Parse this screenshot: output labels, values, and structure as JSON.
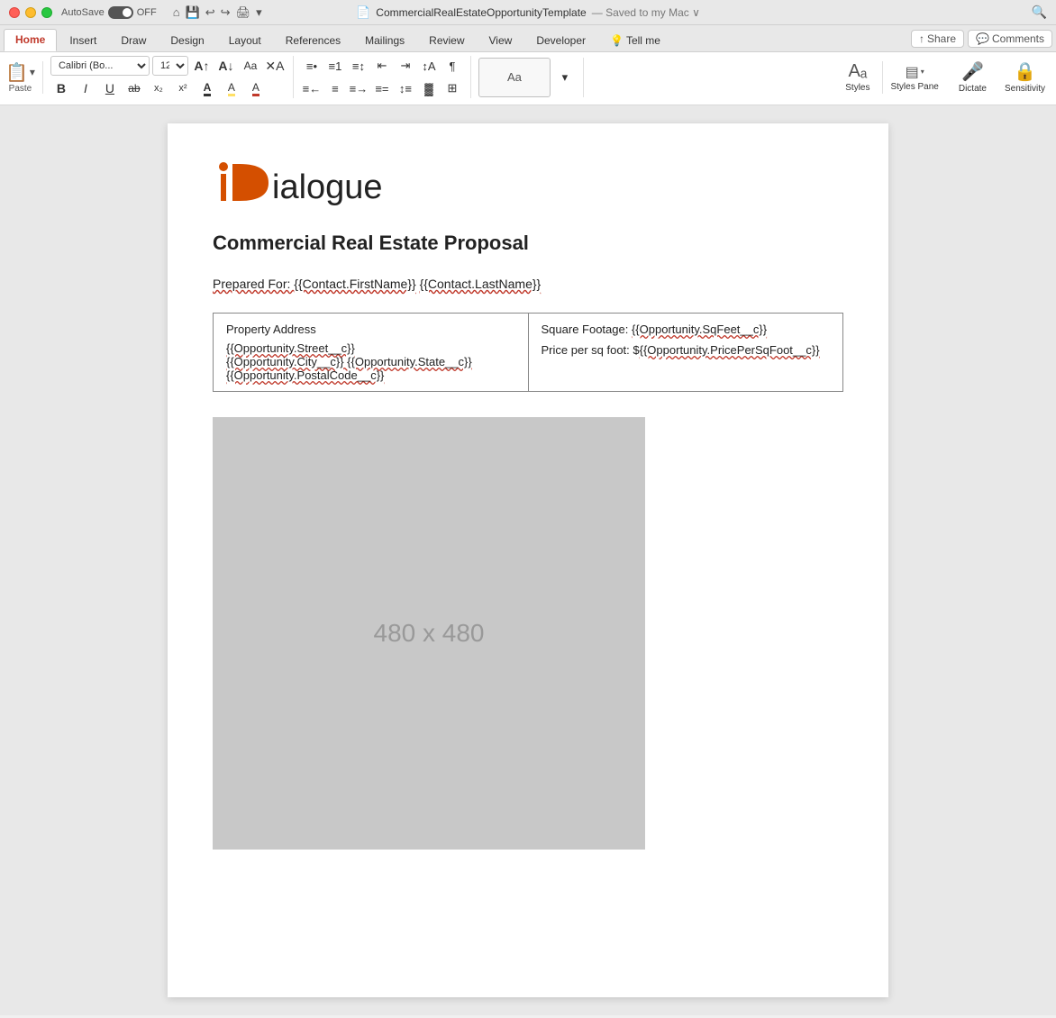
{
  "titlebar": {
    "autosave_label": "AutoSave",
    "toggle_state": "OFF",
    "filename": "CommercialRealEstateOpportunityTemplate",
    "saved_status": "— Saved to my Mac ∨",
    "icons": [
      "home",
      "save",
      "undo",
      "redo",
      "print",
      "more"
    ]
  },
  "ribbon_tabs": {
    "tabs": [
      "Home",
      "Insert",
      "Draw",
      "Design",
      "Layout",
      "References",
      "Mailings",
      "Review",
      "View",
      "Developer"
    ],
    "active_tab": "Home",
    "tell_me": "Tell me",
    "share_label": "Share",
    "comments_label": "Comments"
  },
  "toolbar": {
    "font_name": "Calibri (Bo...",
    "font_size": "12",
    "paste_label": "Paste",
    "bold_label": "B",
    "italic_label": "I",
    "underline_label": "U",
    "styles_label": "Styles",
    "styles_pane_label": "Styles Pane",
    "dictate_label": "Dictate",
    "sensitivity_label": "Sensitivity"
  },
  "document": {
    "title": "Commercial Real Estate Proposal",
    "prepared_for_prefix": "Prepared For: ",
    "contact_first": "{{Contact.FirstName}}",
    "contact_last": "{{Contact.LastName}}",
    "table": {
      "col1_heading": "Property Address",
      "col1_street": "{{Opportunity.Street__c}}",
      "col1_city_state": "{{Opportunity.City__c}} {{Opportunity.State__c}}",
      "col1_postal": "{{Opportunity.PostalCode__c}}",
      "col2_sqft": "Square Footage: {{Opportunity.SqFeet__c}}",
      "col2_price": "Price per sq foot: ${{Opportunity.PricePerSqFoot__c}}"
    },
    "image_placeholder": "480 x 480"
  }
}
